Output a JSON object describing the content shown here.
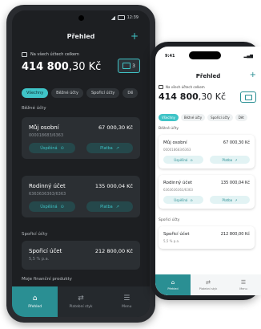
{
  "android": {
    "status_time": "12:39",
    "header": {
      "title": "Přehled"
    },
    "summary": {
      "label": "Na všech účtech celkem",
      "total_int": "414 800",
      "total_dec": ",30 Kč",
      "cards_count": "3"
    },
    "filters": [
      "Všechny",
      "Běžné účty",
      "Spořicí účty",
      "Dě"
    ],
    "sections": {
      "current": "Běžné účty",
      "savings": "Spořicí účty",
      "products": "Moje finanční produkty"
    },
    "accounts": [
      {
        "name": "Můj osobní",
        "amount": "67 000,30 Kč",
        "number": "000018683/6363",
        "btn_left": "Úspěšná",
        "btn_right": "Platba"
      },
      {
        "name": "Rodinný účet",
        "amount": "135 000,04 Kč",
        "number": "6363636363/6363",
        "btn_left": "Úspěšná",
        "btn_right": "Platba"
      }
    ],
    "savings_account": {
      "name": "Spořicí účet",
      "amount": "212 800,00 Kč",
      "rate": "5,5 % p.a."
    },
    "nav": {
      "overview": "Přehled",
      "payments": "Platební styk",
      "menu": "Menu"
    }
  },
  "iphone": {
    "status_time": "9:41",
    "header": {
      "title": "Přehled"
    },
    "summary": {
      "label": "Na všech účtech celkem",
      "total_int": "414 800",
      "total_dec": ",30 Kč"
    },
    "filters": [
      "Všechny",
      "Běžné účty",
      "Spořicí účty",
      "Dět"
    ],
    "sections": {
      "current": "Běžné účty",
      "savings": "Spořicí účty"
    },
    "accounts": [
      {
        "name": "Můj osobní",
        "amount": "67 000,30 Kč",
        "number": "000018683/6363",
        "btn_left": "Úspěšná",
        "btn_right": "Platba"
      },
      {
        "name": "Rodinný účet",
        "amount": "135 000,04 Kč",
        "number": "6363636363/6363",
        "btn_left": "Úspěšná",
        "btn_right": "Platba"
      }
    ],
    "savings_account": {
      "name": "Spořicí účet",
      "amount": "212 800,00 Kč",
      "rate": "5,5 % p.a."
    },
    "nav": {
      "overview": "Přehled",
      "payments": "Platební styk",
      "menu": "Menu"
    }
  },
  "colors": {
    "accent": "#3fc4c7",
    "dark_bg": "#1d1f22",
    "card_dark": "#2b2f33"
  }
}
